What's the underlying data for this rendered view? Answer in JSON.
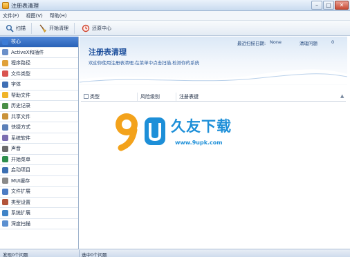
{
  "window": {
    "title": "注册表清理"
  },
  "menu": [
    "文件(F)",
    "视图(V)",
    "帮助(H)"
  ],
  "toolbar": {
    "scan_label": "扫描",
    "clean_label": "开始清理",
    "restore_label": "还原中心"
  },
  "sidebar": {
    "items": [
      {
        "label": "核心",
        "icon": "registry-icon",
        "color": "#3b7bd6"
      },
      {
        "label": "ActiveX和插件",
        "icon": "activex-icon",
        "color": "#6a8fc9"
      },
      {
        "label": "程序路径",
        "icon": "program-path-icon",
        "color": "#e0a13a"
      },
      {
        "label": "文件类型",
        "icon": "file-type-icon",
        "color": "#d9534f"
      },
      {
        "label": "字体",
        "icon": "font-icon",
        "color": "#3f6fb5"
      },
      {
        "label": "帮助文件",
        "icon": "help-file-icon",
        "color": "#f0b429"
      },
      {
        "label": "历史记录",
        "icon": "history-icon",
        "color": "#4a8f47"
      },
      {
        "label": "共享文件",
        "icon": "shared-file-icon",
        "color": "#c9923a"
      },
      {
        "label": "快捷方式",
        "icon": "shortcut-icon",
        "color": "#5b7fb8"
      },
      {
        "label": "系统软件",
        "icon": "software-icon",
        "color": "#7a6db0"
      },
      {
        "label": "声音",
        "icon": "sound-icon",
        "color": "#6b6b6b"
      },
      {
        "label": "开始菜单",
        "icon": "start-menu-icon",
        "color": "#2f8f4e"
      },
      {
        "label": "启动项目",
        "icon": "startup-icon",
        "color": "#3c6fb2"
      },
      {
        "label": "MUI缓存",
        "icon": "mui-cache-icon",
        "color": "#8a8a8a"
      },
      {
        "label": "文件扩展",
        "icon": "file-ext-icon",
        "color": "#4c7cc4"
      },
      {
        "label": "类型设置",
        "icon": "type-settings-icon",
        "color": "#b3543a"
      },
      {
        "label": "系统扩展",
        "icon": "system-ext-icon",
        "color": "#3f83c7"
      },
      {
        "label": "深度扫描",
        "icon": "deep-scan-icon",
        "color": "#5a8fd0"
      }
    ]
  },
  "header": {
    "title": "注册表清理",
    "description": "欢迎你使用注册表清理,在菜单中点击扫描,检测你的系统",
    "last_scan_label": "最近扫描日期:",
    "last_scan_value": "None",
    "issues_label": "清理问题",
    "issues_count": "0"
  },
  "list": {
    "columns": [
      "类型",
      "风险级别",
      "注册表键"
    ]
  },
  "watermark": {
    "text": "久友下载",
    "url": "www.9upk.com"
  },
  "status": {
    "left": "发现0个问题",
    "right": "选中0个问题"
  }
}
